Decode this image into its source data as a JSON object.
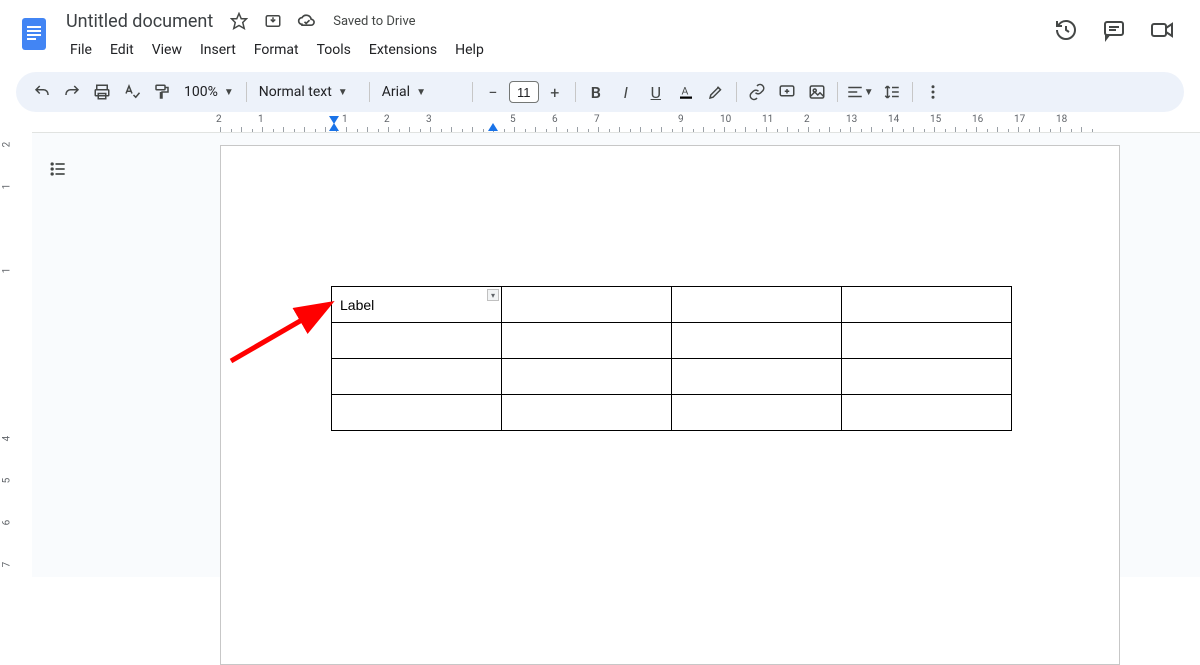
{
  "header": {
    "doc_title": "Untitled document",
    "saved_status": "Saved to Drive",
    "menu": [
      "File",
      "Edit",
      "View",
      "Insert",
      "Format",
      "Tools",
      "Extensions",
      "Help"
    ]
  },
  "toolbar": {
    "zoom": "100%",
    "style": "Normal text",
    "font": "Arial",
    "font_size": "11"
  },
  "ruler": {
    "horizontal": [
      "2",
      "1",
      "",
      "1",
      "2",
      "3",
      "",
      "5",
      "6",
      "7",
      "",
      "9",
      "10",
      "11",
      "2",
      "13",
      "14",
      "15",
      "16",
      "17",
      "18"
    ],
    "vertical": [
      "2",
      "1",
      "",
      "1",
      "",
      "",
      "",
      "4",
      "5",
      "6",
      "7"
    ]
  },
  "table": {
    "rows": [
      [
        "Label",
        "",
        "",
        ""
      ],
      [
        "",
        "",
        "",
        ""
      ],
      [
        "",
        "",
        "",
        ""
      ],
      [
        "",
        "",
        "",
        ""
      ]
    ]
  },
  "colors": {
    "accent_blue": "#1a73e8",
    "toolbar_bg": "#edf2fa",
    "canvas_bg": "#f9fbfd"
  }
}
